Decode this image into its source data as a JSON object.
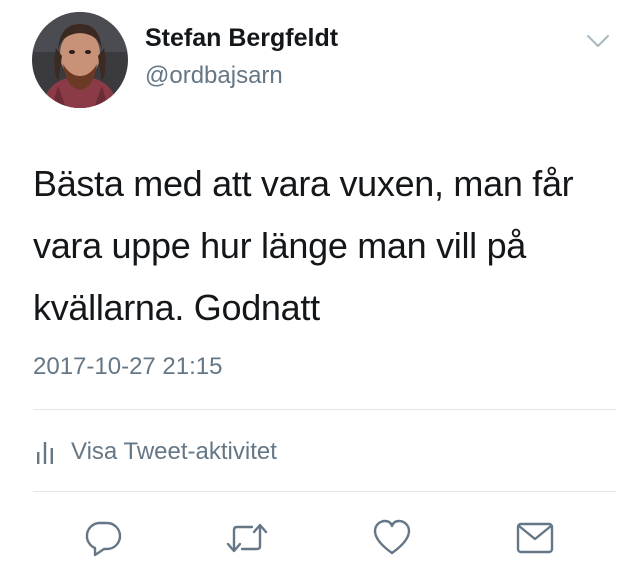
{
  "tweet": {
    "author": {
      "display_name": "Stefan Bergfeldt",
      "handle": "@ordbajsarn",
      "avatar_icon": "user-avatar"
    },
    "caret_icon": "chevron-down-icon",
    "text": "Bästa med att vara vuxen, man får vara uppe hur länge man vill på kvällarna. Godnatt",
    "timestamp": "2017-10-27 21:15",
    "activity": {
      "icon": "bar-chart-icon",
      "label": "Visa Tweet-aktivitet"
    },
    "actions": [
      {
        "icon": "reply-icon"
      },
      {
        "icon": "retweet-icon"
      },
      {
        "icon": "like-icon"
      },
      {
        "icon": "direct-message-icon"
      }
    ]
  },
  "colors": {
    "text_primary": "#14171a",
    "text_secondary": "#657786",
    "divider": "#e1e8ed",
    "icon": "#657786"
  }
}
